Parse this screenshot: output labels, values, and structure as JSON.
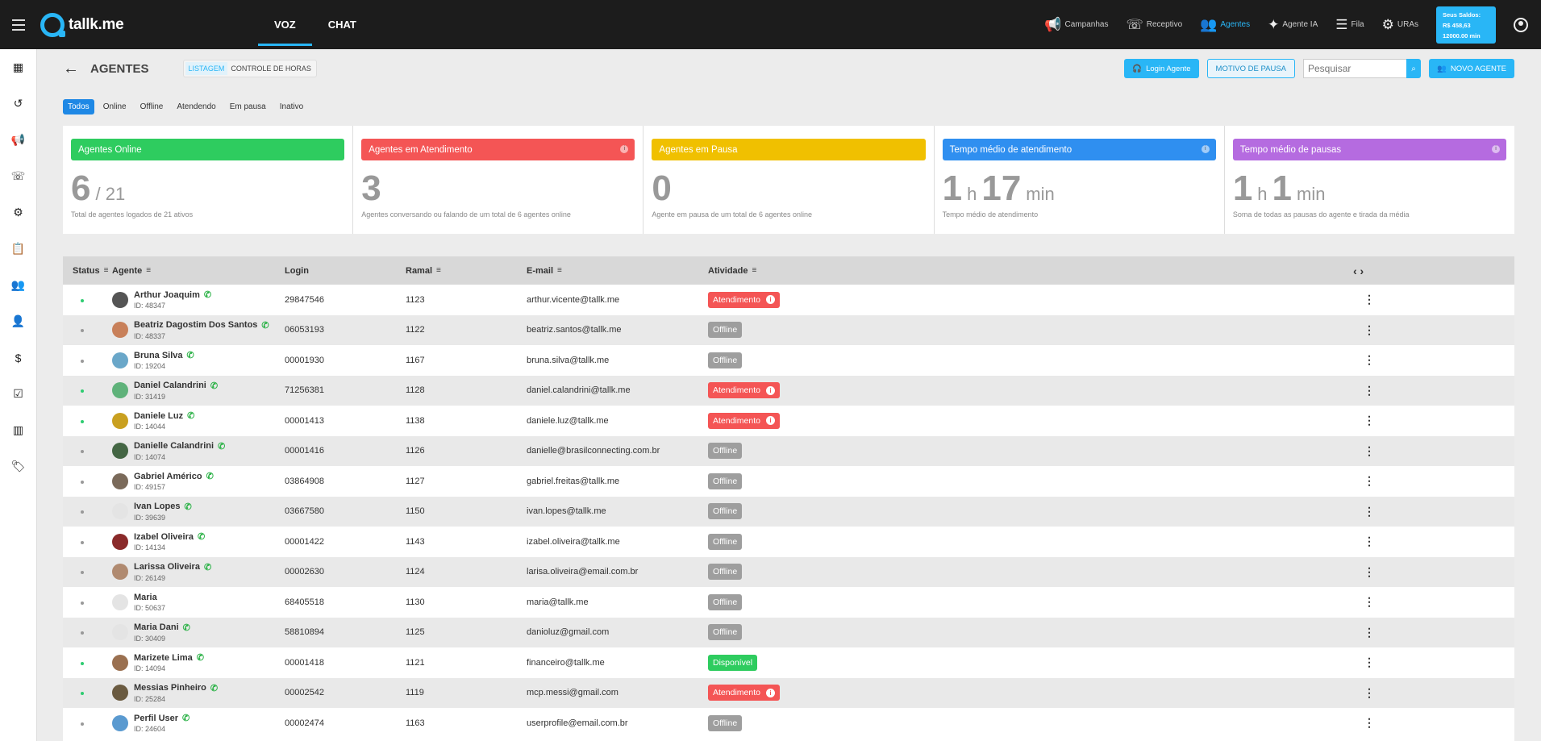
{
  "brand": {
    "logo_text": "tallk.me"
  },
  "modes": [
    {
      "label": "VOZ"
    },
    {
      "label": "CHAT"
    }
  ],
  "top_nav": [
    {
      "label": "Campanhas",
      "icon": "megaphone-icon"
    },
    {
      "label": "Receptivo",
      "icon": "phone-incoming-icon"
    },
    {
      "label": "Agentes",
      "icon": "agents-icon"
    },
    {
      "label": "Agente IA",
      "icon": "sparkle-icon"
    },
    {
      "label": "Fila",
      "icon": "queue-icon"
    },
    {
      "label": "URAs",
      "icon": "gear-icon"
    }
  ],
  "balance": {
    "title": "Seus Saldos:",
    "amount": "R$ 458,63",
    "minutes": "12000.00 min"
  },
  "page": {
    "title": "AGENTES",
    "subtabs": [
      {
        "label": "LISTAGEM"
      },
      {
        "label": "CONTROLE DE HORAS"
      }
    ],
    "btn_login": "Login Agente",
    "btn_pause": "MOTIVO DE PAUSA",
    "search_placeholder": "Pesquisar",
    "btn_new": "NOVO AGENTE"
  },
  "filters": [
    "Todos",
    "Online",
    "Offline",
    "Atendendo",
    "Em pausa",
    "Inativo"
  ],
  "cards": [
    {
      "title": "Agentes Online",
      "color": "#2ecc5f",
      "value": "6",
      "suffix": "/ 21",
      "desc": "Total de agentes logados de 21 ativos"
    },
    {
      "title": "Agentes em Atendimento",
      "color": "#f45555",
      "value": "3",
      "desc": "Agentes conversando ou falando de um total de 6 agentes online"
    },
    {
      "title": "Agentes em Pausa",
      "color": "#f0c000",
      "value": "0",
      "desc": "Agente em pausa de um total de 6 agentes online"
    },
    {
      "title": "Tempo médio de atendimento",
      "color": "#2f8ff0",
      "h": "1",
      "h_unit": "h",
      "m": "17",
      "m_unit": "min",
      "desc": "Tempo médio de atendimento"
    },
    {
      "title": "Tempo médio de pausas",
      "color": "#b56be0",
      "h": "1",
      "h_unit": "h",
      "m": "1",
      "m_unit": "min",
      "desc": "Soma de todas as pausas do agente e tirada da média"
    }
  ],
  "table": {
    "headers": {
      "status": "Status",
      "agent": "Agente",
      "login": "Login",
      "ramal": "Ramal",
      "email": "E-mail",
      "activity": "Atividade",
      "nav": "‹ ›"
    },
    "rows": [
      {
        "name": "Arthur Joaquim",
        "id": "ID: 48347",
        "login": "29847546",
        "ramal": "1123",
        "email": "arthur.vicente@tallk.me",
        "status": "Atendimento",
        "online": true,
        "wa": true,
        "av": "#555"
      },
      {
        "name": "Beatriz Dagostim Dos Santos",
        "id": "ID: 48337",
        "login": "06053193",
        "ramal": "1122",
        "email": "beatriz.santos@tallk.me",
        "status": "Offline",
        "online": false,
        "wa": true,
        "av": "#c8805a"
      },
      {
        "name": "Bruna Silva",
        "id": "ID: 19204",
        "login": "00001930",
        "ramal": "1167",
        "email": "bruna.silva@tallk.me",
        "status": "Offline",
        "online": false,
        "wa": true,
        "av": "#6aa7c9"
      },
      {
        "name": "Daniel Calandrini",
        "id": "ID: 31419",
        "login": "71256381",
        "ramal": "1128",
        "email": "daniel.calandrini@tallk.me",
        "status": "Atendimento",
        "online": true,
        "wa": true,
        "av": "#5fb27a"
      },
      {
        "name": "Daniele Luz",
        "id": "ID: 14044",
        "login": "00001413",
        "ramal": "1138",
        "email": "daniele.luz@tallk.me",
        "status": "Atendimento",
        "online": true,
        "wa": true,
        "av": "#c9a020"
      },
      {
        "name": "Danielle Calandrini",
        "id": "ID: 14074",
        "login": "00001416",
        "ramal": "1126",
        "email": "danielle@brasilconnecting.com.br",
        "status": "Offline",
        "online": false,
        "wa": true,
        "av": "#446644"
      },
      {
        "name": "Gabriel Américo",
        "id": "ID: 49157",
        "login": "03864908",
        "ramal": "1127",
        "email": "gabriel.freitas@tallk.me",
        "status": "Offline",
        "online": false,
        "wa": true,
        "av": "#7a6a5a"
      },
      {
        "name": "Ivan Lopes",
        "id": "ID: 39639",
        "login": "03667580",
        "ramal": "1150",
        "email": "ivan.lopes@tallk.me",
        "status": "Offline",
        "online": false,
        "wa": true,
        "av": "#e4e4e4"
      },
      {
        "name": "Izabel Oliveira",
        "id": "ID: 14134",
        "login": "00001422",
        "ramal": "1143",
        "email": "izabel.oliveira@tallk.me",
        "status": "Offline",
        "online": false,
        "wa": true,
        "av": "#8a2a2a"
      },
      {
        "name": "Larissa Oliveira",
        "id": "ID: 26149",
        "login": "00002630",
        "ramal": "1124",
        "email": "larisa.oliveira@email.com.br",
        "status": "Offline",
        "online": false,
        "wa": true,
        "av": "#b08a70"
      },
      {
        "name": "Maria",
        "id": "ID: 50637",
        "login": "68405518",
        "ramal": "1130",
        "email": "maria@tallk.me",
        "status": "Offline",
        "online": false,
        "wa": false,
        "av": "#e4e4e4"
      },
      {
        "name": "Maria Dani",
        "id": "ID: 30409",
        "login": "58810894",
        "ramal": "1125",
        "email": "danioluz@gmail.com",
        "status": "Offline",
        "online": false,
        "wa": true,
        "av": "#e4e4e4"
      },
      {
        "name": "Marizete Lima",
        "id": "ID: 14094",
        "login": "00001418",
        "ramal": "1121",
        "email": "financeiro@tallk.me",
        "status": "Disponível",
        "online": true,
        "wa": true,
        "av": "#9a7050"
      },
      {
        "name": "Messias Pinheiro",
        "id": "ID: 25284",
        "login": "00002542",
        "ramal": "1119",
        "email": "mcp.messi@gmail.com",
        "status": "Atendimento",
        "online": true,
        "wa": true,
        "av": "#6a5a40"
      },
      {
        "name": "Perfil User",
        "id": "ID: 24604",
        "login": "00002474",
        "ramal": "1163",
        "email": "userprofile@email.com.br",
        "status": "Offline",
        "online": false,
        "wa": true,
        "av": "#5a9ad0"
      }
    ]
  },
  "status_colors": {
    "Atendimento": "#f45555",
    "Offline": "#9e9e9e",
    "Disponível": "#2ecc5f"
  }
}
